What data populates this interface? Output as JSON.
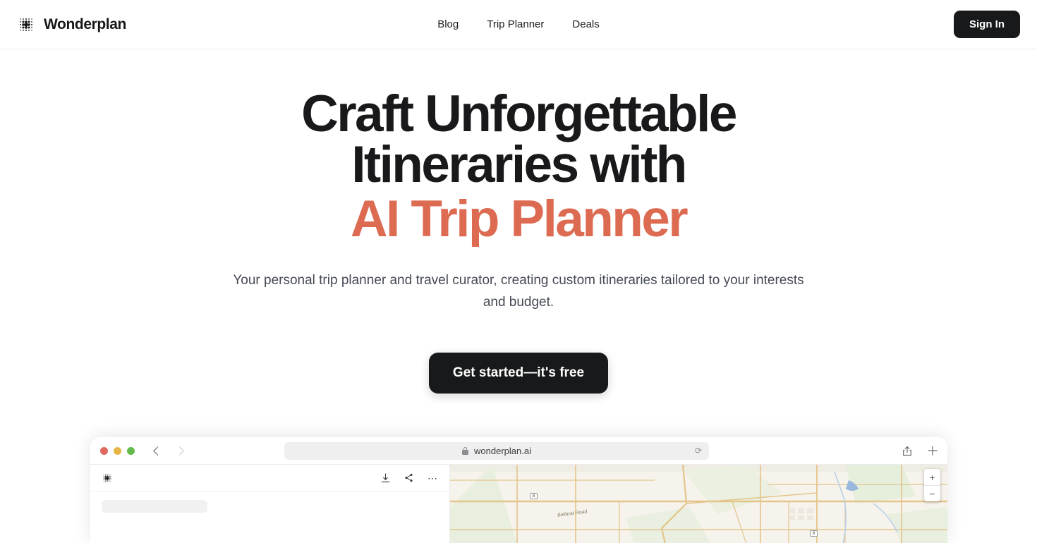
{
  "header": {
    "brand_name": "Wonderplan",
    "logo_icon": "dot-matrix-logo-icon",
    "nav": [
      {
        "label": "Blog"
      },
      {
        "label": "Trip Planner"
      },
      {
        "label": "Deals"
      }
    ],
    "signin_label": "Sign In"
  },
  "hero": {
    "headline_line1": "Craft Unforgettable",
    "headline_line2": "Itineraries with",
    "headline_line3": "AI Trip Planner",
    "accent_color": "#dd6b52",
    "subtitle": "Your personal trip planner and travel curator, creating custom itineraries tailored to your interests and budget.",
    "cta_label": "Get started—it's free"
  },
  "browser": {
    "traffic_lights": [
      "close-red",
      "minimize-yellow",
      "maximize-green"
    ],
    "back_icon": "chevron-left-icon",
    "forward_icon": "chevron-right-icon",
    "lock_icon": "lock-icon",
    "url": "wonderplan.ai",
    "reload_icon": "reload-icon",
    "share_icon": "share-icon",
    "newtab_icon": "plus-icon"
  },
  "app": {
    "logo_icon": "dot-matrix-logo-icon",
    "toolbar_icons": [
      {
        "name": "download-icon",
        "glyph": "⤓"
      },
      {
        "name": "share-nodes-icon",
        "glyph": "⮩"
      },
      {
        "name": "more-options-icon",
        "glyph": "⋯"
      }
    ],
    "map": {
      "road_label": "Ballarat Road",
      "highway_shield_1": "8",
      "highway_shield_2": "8",
      "zoom_in_label": "+",
      "zoom_out_label": "−"
    }
  }
}
